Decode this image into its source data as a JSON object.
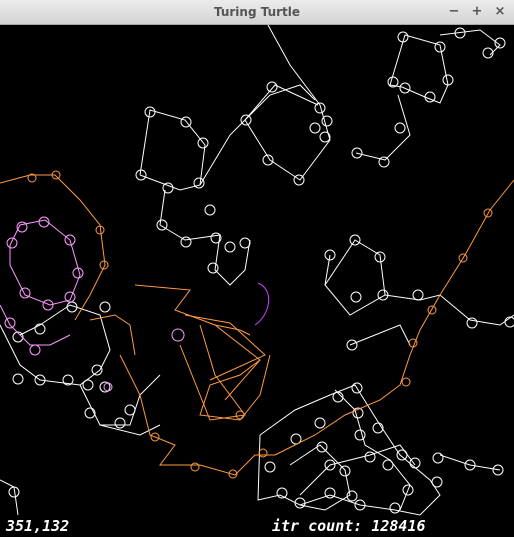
{
  "window": {
    "title": "Turing Turtle",
    "minimize_glyph": "−",
    "maximize_glyph": "+",
    "close_glyph": "×"
  },
  "status": {
    "cursor_coords": "351,132",
    "iteration_label": "itr count: 128416"
  },
  "colors": {
    "background": "#000000",
    "trail_white": "#ffffff",
    "trail_orange": "#ff9a40",
    "trail_pink": "#ff99ff",
    "trail_magenta": "#cc44ff"
  }
}
